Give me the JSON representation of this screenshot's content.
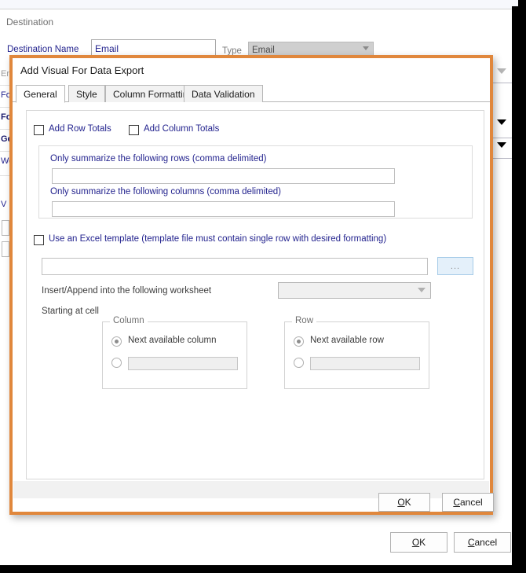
{
  "background": {
    "section_title": "Destination",
    "destination_name_label": "Destination Name",
    "destination_name_value": "Email",
    "type_label": "Type",
    "type_value": "Email",
    "left_items": [
      {
        "label": "Em",
        "style": "grey"
      },
      {
        "label": "Fo",
        "style": "normal"
      },
      {
        "label": "Fo",
        "style": "bold"
      },
      {
        "label": "Ge",
        "style": "bold"
      },
      {
        "label": "Wo",
        "style": "normal"
      },
      {
        "label": "V",
        "style": "normal"
      }
    ],
    "ok_label": "OK",
    "cancel_label": "Cancel"
  },
  "dialog": {
    "title": "Add Visual For Data Export",
    "tabs": [
      {
        "label": "General",
        "active": true
      },
      {
        "label": "Style",
        "active": false
      },
      {
        "label": "Column Formatting",
        "active": false
      },
      {
        "label": "Data Validation",
        "active": false
      }
    ],
    "add_row_totals_label": "Add Row Totals",
    "add_column_totals_label": "Add Column Totals",
    "summarize_rows_label": "Only summarize the following rows (comma delimited)",
    "summarize_rows_value": "",
    "summarize_columns_label": "Only summarize the following columns (comma delimited)",
    "summarize_columns_value": "",
    "use_template_label": "Use an Excel template (template file must contain single row with desired formatting)",
    "template_path_value": "",
    "browse_label": "...",
    "worksheet_label": "Insert/Append into the following worksheet",
    "worksheet_value": "",
    "starting_at_cell_label": "Starting at cell",
    "column_group_title": "Column",
    "next_available_column_label": "Next available column",
    "column_custom_value": "",
    "row_group_title": "Row",
    "next_available_row_label": "Next available row",
    "row_custom_value": "",
    "ok_label": "OK",
    "cancel_label": "Cancel"
  },
  "colors": {
    "accent_orange": "#e0873c",
    "label_blue": "#23238e",
    "browse_hover": "#e4f0fa"
  }
}
